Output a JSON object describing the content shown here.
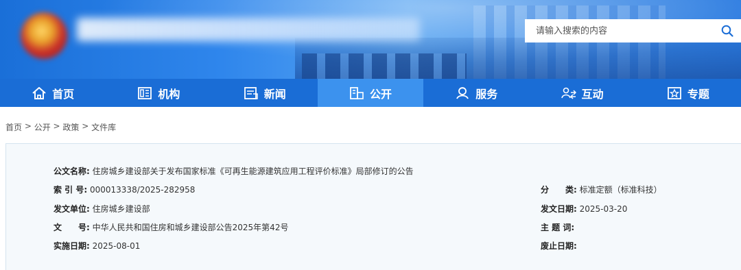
{
  "header": {
    "search_placeholder": "请输入搜索的内容"
  },
  "nav": {
    "items": [
      {
        "label": "首页",
        "icon": "home-icon"
      },
      {
        "label": "机构",
        "icon": "org-icon"
      },
      {
        "label": "新闻",
        "icon": "news-icon"
      },
      {
        "label": "公开",
        "icon": "open-icon",
        "active": true
      },
      {
        "label": "服务",
        "icon": "service-icon"
      },
      {
        "label": "互动",
        "icon": "interact-icon"
      },
      {
        "label": "专题",
        "icon": "topic-icon"
      }
    ]
  },
  "breadcrumb": [
    "首页",
    "公开",
    "政策",
    "文件库"
  ],
  "breadcrumb_sep": " > ",
  "document": {
    "title_label": "公文名称:",
    "title": "住房城乡建设部关于发布国家标准《可再生能源建筑应用工程评价标准》局部修订的公告",
    "index_label": "索 引 号:",
    "index": "000013338/2025-282958",
    "category_label": "分　　类:",
    "category": "标准定额（标准科技）",
    "issuer_label": "发文单位:",
    "issuer": "住房城乡建设部",
    "date_label": "发文日期:",
    "date": "2025-03-20",
    "docno_label": "文　　号:",
    "docno": "中华人民共和国住房和城乡建设部公告2025年第42号",
    "subject_label": "主 题 词:",
    "subject": "",
    "effective_label": "实施日期:",
    "effective": "2025-08-01",
    "expiry_label": "废止日期:",
    "expiry": ""
  },
  "colors": {
    "nav_bg": "#1a6dd6",
    "nav_active": "#3c92ee",
    "panel_bg": "#f5f9fc",
    "search_icon": "#1a6dd6"
  }
}
